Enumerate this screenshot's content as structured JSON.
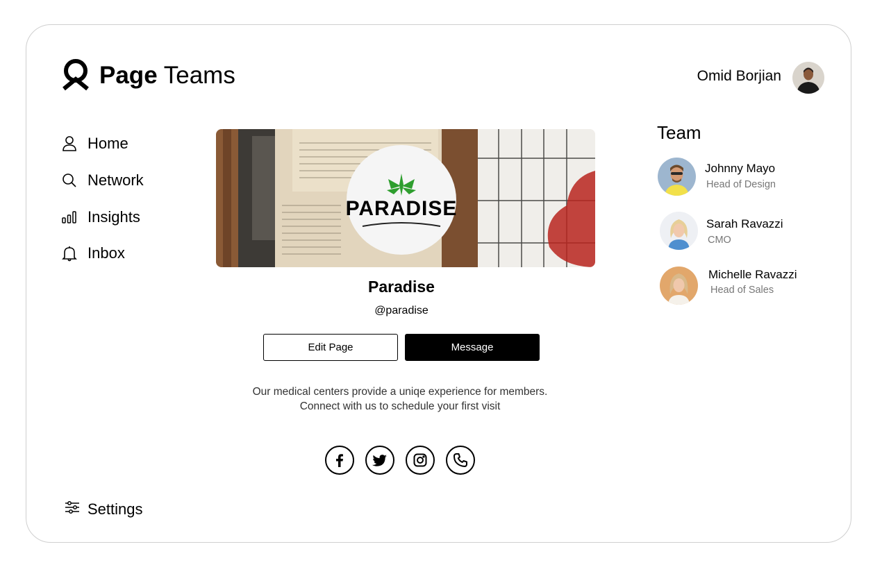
{
  "brand": {
    "name_bold": "Page",
    "name_light": "Teams",
    "icon": "page-teams-logo-icon"
  },
  "user": {
    "name": "Omid Borjian",
    "avatar": "user-avatar"
  },
  "nav": {
    "items": [
      {
        "label": "Home",
        "icon": "person-icon"
      },
      {
        "label": "Network",
        "icon": "search-icon"
      },
      {
        "label": "Insights",
        "icon": "bar-chart-icon"
      },
      {
        "label": "Inbox",
        "icon": "bell-icon"
      }
    ],
    "settings": {
      "label": "Settings",
      "icon": "sliders-icon"
    }
  },
  "page": {
    "logo_text": "PARADISE",
    "title": "Paradise",
    "handle": "@paradise",
    "edit_label": "Edit Page",
    "message_label": "Message",
    "description_line1": "Our medical centers provide a uniqe experience for members.",
    "description_line2": "Connect with us to schedule your first visit",
    "social": [
      "facebook-icon",
      "twitter-icon",
      "instagram-icon",
      "phone-icon"
    ]
  },
  "team": {
    "title": "Team",
    "members": [
      {
        "name": "Johnny Mayo",
        "role": "Head of Design"
      },
      {
        "name": "Sarah Ravazzi",
        "role": "CMO"
      },
      {
        "name": "Michelle Ravazzi",
        "role": "Head of Sales"
      }
    ]
  },
  "colors": {
    "primary": "#000000",
    "muted": "#777777",
    "border": "#cfcfcf",
    "leaf": "#2e9e2e"
  }
}
